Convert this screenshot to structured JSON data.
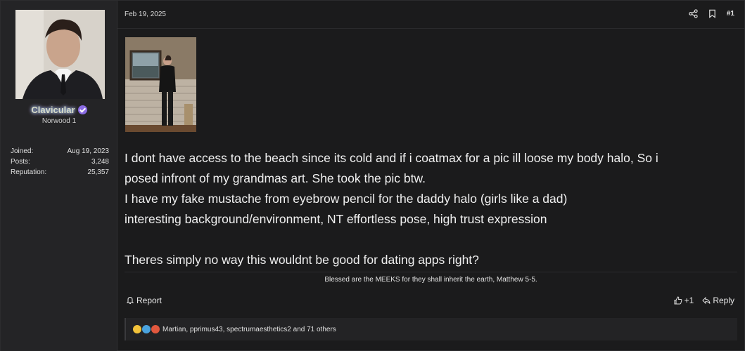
{
  "user": {
    "name": "Clavicular",
    "title": "Norwood 1",
    "stats": [
      {
        "label": "Joined:",
        "value": "Aug 19, 2023"
      },
      {
        "label": "Posts:",
        "value": "3,248"
      },
      {
        "label": "Reputation:",
        "value": "25,357"
      }
    ]
  },
  "post": {
    "date": "Feb 19, 2025",
    "number": "#1",
    "body": {
      "line1": "I dont have access to the beach since its cold and if i coatmax for a pic ill loose my body halo, So i",
      "line2": "posed infront of my grandmas art. She took the pic btw.",
      "line3": "I have my fake mustache from eyebrow pencil for the daddy halo (girls like a dad)",
      "line4": "interesting background/environment, NT effortless pose, high trust expression",
      "line5": "Theres simply no way this wouldnt be good for dating apps right?"
    },
    "signature": "Blessed are the MEEKS for they shall inherit the earth, Matthew 5-5.",
    "actions": {
      "report": "Report",
      "like_count": "+1",
      "reply": "Reply"
    },
    "reactions_text": "Martian, pprimus43, spectrumaesthetics2 and 71 others"
  },
  "icons": [
    "verified-icon",
    "share-icon",
    "bookmark-icon",
    "report-bell-icon",
    "thumbs-up-icon",
    "reply-icon",
    "reaction-icons"
  ],
  "colors": {
    "background": "#1b1b1c",
    "sidebar": "#242426",
    "verified": "#8a6be3"
  }
}
